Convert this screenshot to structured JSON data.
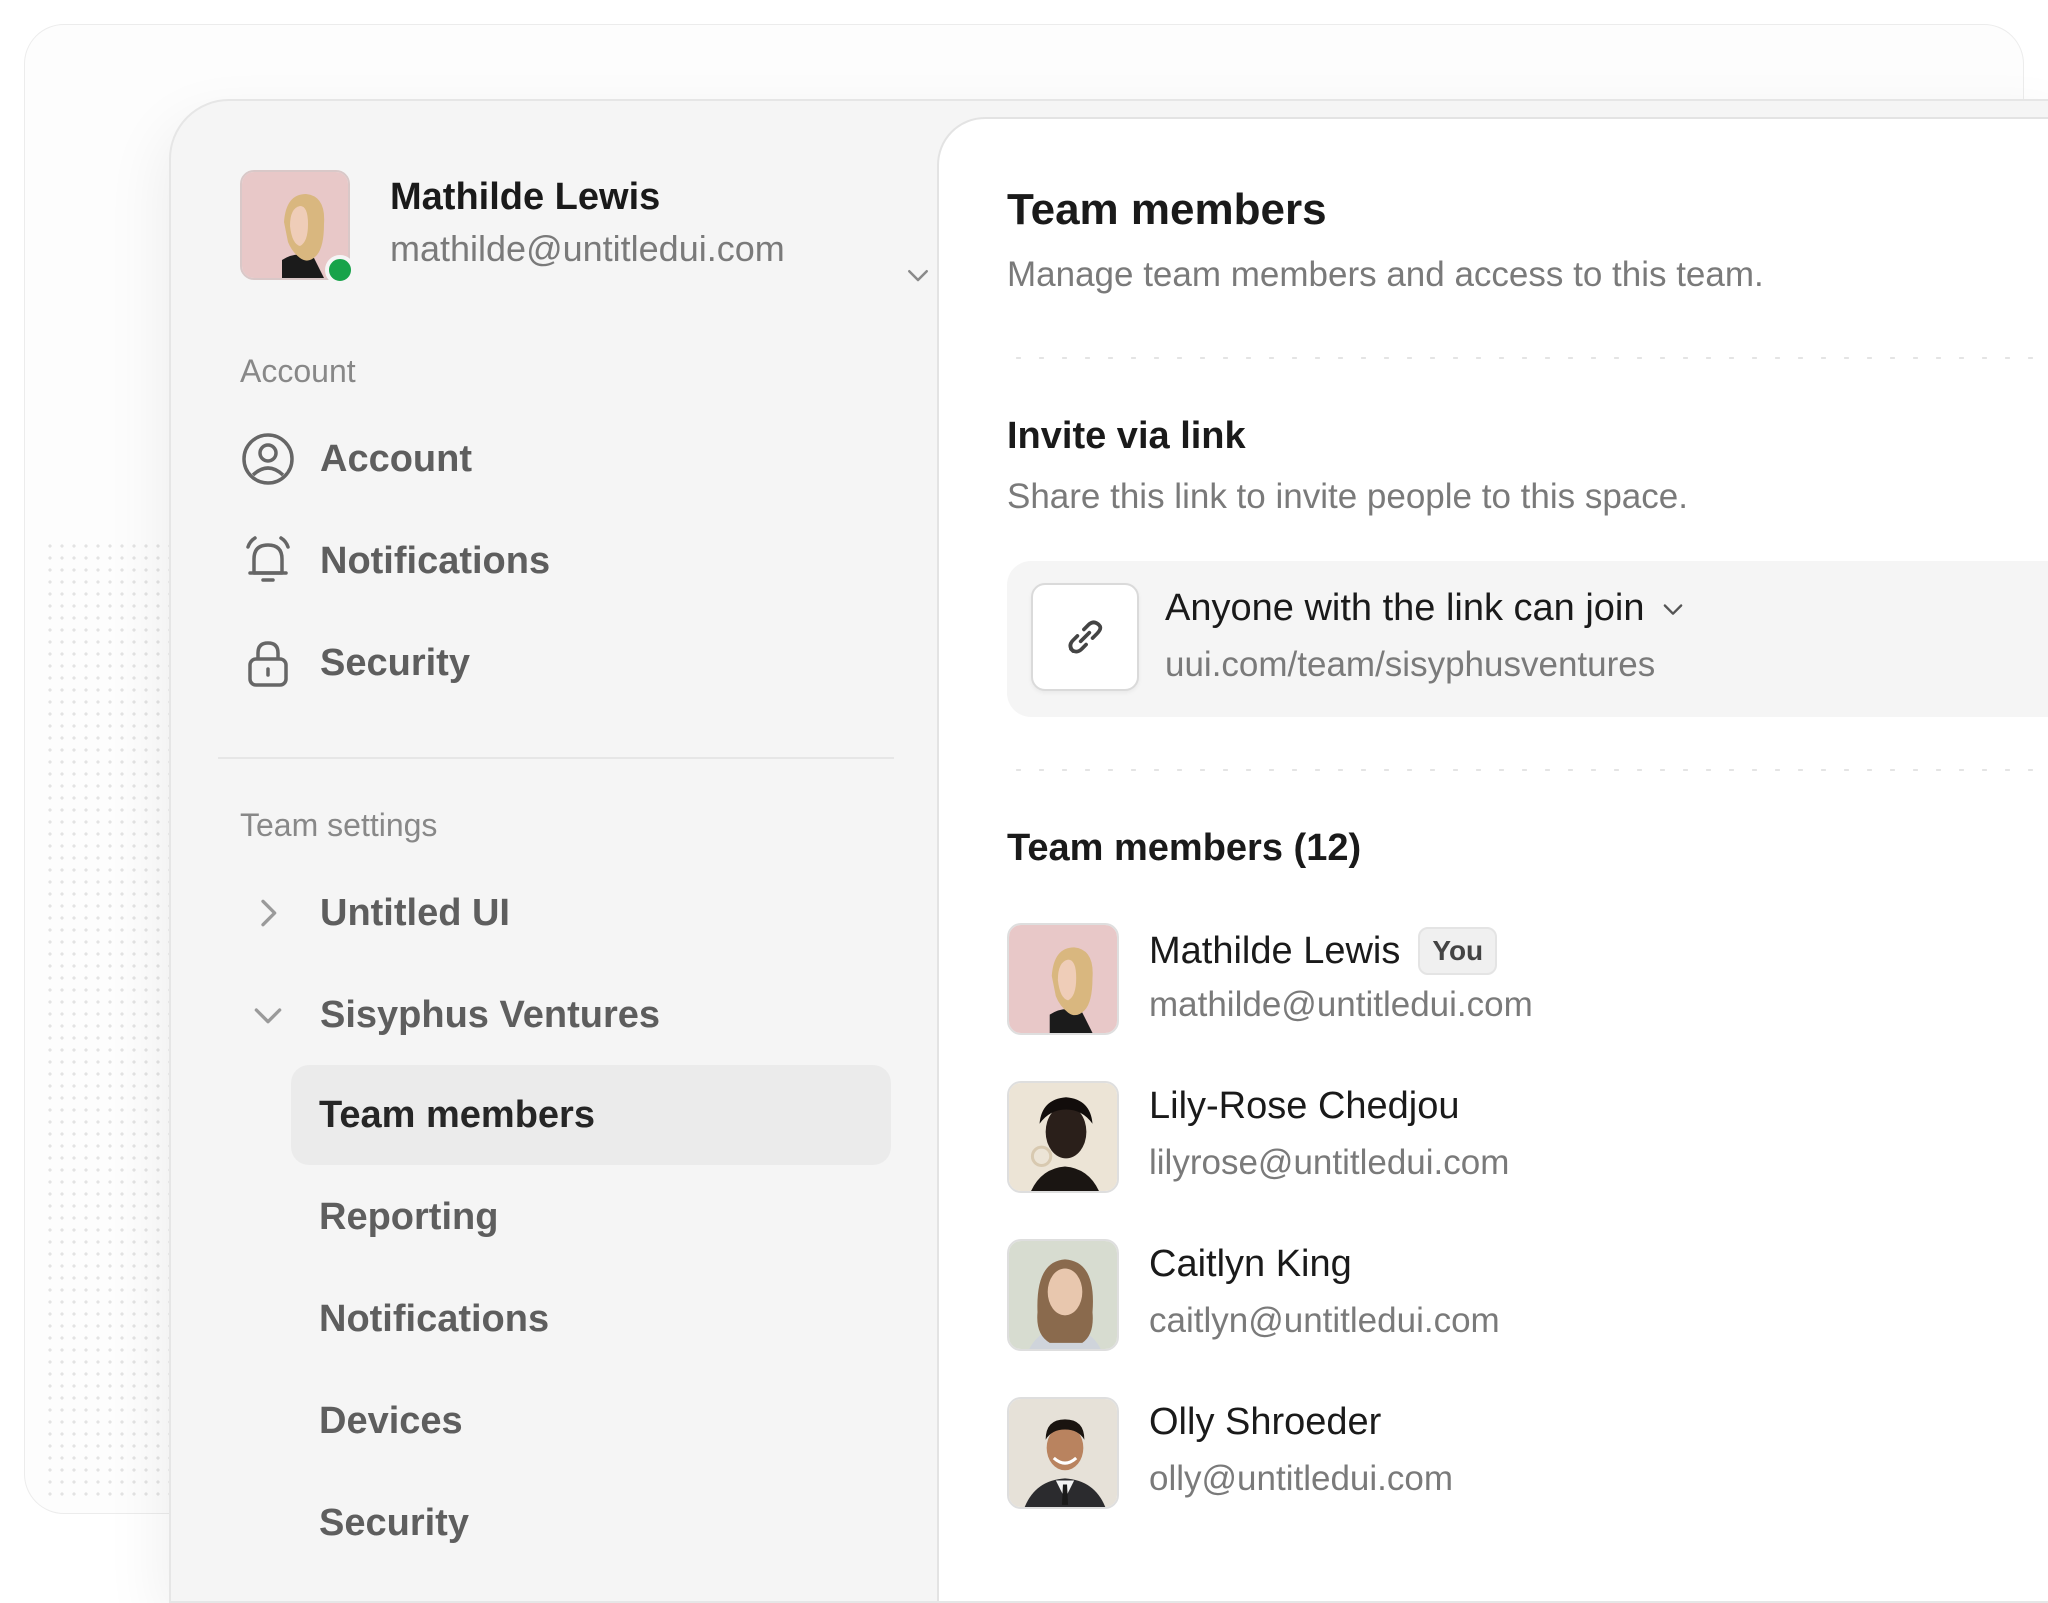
{
  "profile": {
    "name": "Mathilde Lewis",
    "email": "mathilde@untitledui.com"
  },
  "sidebar": {
    "account_section_label": "Account",
    "account_items": [
      {
        "label": "Account",
        "icon": "user-circle-icon"
      },
      {
        "label": "Notifications",
        "icon": "bell-icon"
      },
      {
        "label": "Security",
        "icon": "lock-icon"
      }
    ],
    "team_section_label": "Team settings",
    "teams": [
      {
        "label": "Untitled UI",
        "icon": "chevron-right-icon"
      },
      {
        "label": "Sisyphus Ventures",
        "icon": "chevron-down-icon"
      }
    ],
    "sub_items": [
      {
        "label": "Team members",
        "active": true
      },
      {
        "label": "Reporting"
      },
      {
        "label": "Notifications"
      },
      {
        "label": "Devices"
      },
      {
        "label": "Security"
      }
    ]
  },
  "main": {
    "title": "Team members",
    "subtitle": "Manage team members and access to this team.",
    "invite": {
      "heading": "Invite via link",
      "description": "Share this link to invite people to this space.",
      "access_label": "Anyone with the link can join",
      "url": "uui.com/team/sisyphusventures",
      "icon": "link-icon"
    },
    "members_heading": "Team members (12)",
    "members": [
      {
        "name": "Mathilde Lewis",
        "email": "mathilde@untitledui.com",
        "badge": "You"
      },
      {
        "name": "Lily-Rose Chedjou",
        "email": "lilyrose@untitledui.com"
      },
      {
        "name": "Caitlyn King",
        "email": "caitlyn@untitledui.com"
      },
      {
        "name": "Olly Shroeder",
        "email": "olly@untitledui.com"
      }
    ]
  },
  "colors": {
    "online": "#17a34a",
    "sidebar_bg": "#f5f5f5",
    "active_item_bg": "#ebebeb",
    "muted_text": "#7a7a7a"
  }
}
